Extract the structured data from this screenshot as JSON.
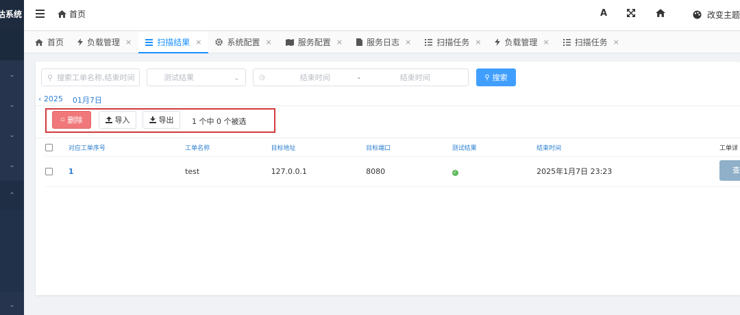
{
  "app": {
    "title_fragment": "估系统"
  },
  "header": {
    "breadcrumb": "首页",
    "tools": {
      "font_icon_label": "A",
      "theme_label": "改变主题"
    }
  },
  "tabs": [
    {
      "label": "首页",
      "icon": "home-icon",
      "closable": false,
      "active": false
    },
    {
      "label": "负载管理",
      "icon": "bolt-icon",
      "closable": true,
      "active": false
    },
    {
      "label": "扫描结果",
      "icon": "list-icon",
      "closable": true,
      "active": true
    },
    {
      "label": "系统配置",
      "icon": "gear-icon",
      "closable": true,
      "active": false
    },
    {
      "label": "服务配置",
      "icon": "map-icon",
      "closable": true,
      "active": false
    },
    {
      "label": "服务日志",
      "icon": "file-icon",
      "closable": true,
      "active": false
    },
    {
      "label": "扫描任务",
      "icon": "tasks-icon",
      "closable": true,
      "active": false
    },
    {
      "label": "负载管理",
      "icon": "bolt-icon",
      "closable": true,
      "active": false
    },
    {
      "label": "扫描任务",
      "icon": "tasks-icon",
      "closable": true,
      "active": false
    }
  ],
  "search": {
    "keyword_placeholder": "搜索工单名称,结束时间",
    "result_placeholder": "测试结果",
    "end_time_from_placeholder": "结束时间",
    "range_separator": "-",
    "end_time_to_placeholder": "结束时间",
    "search_button": "搜索"
  },
  "date_nav": {
    "year": "‹ 2025",
    "day": "01月7日"
  },
  "toolbar": {
    "delete_label": "删除",
    "import_label": "导入",
    "export_label": "导出",
    "selection_text": "1 个中 0 个被选"
  },
  "table": {
    "columns": [
      "对应工单序号",
      "工单名称",
      "目标地址",
      "目标端口",
      "测试结果",
      "结束时间",
      "工单详"
    ],
    "rows": [
      {
        "id": "1",
        "name": "test",
        "address": "127.0.0.1",
        "port": "8080",
        "result_icon": "check-circle-icon",
        "end_time": "2025年1月7日 23:23",
        "action": "查"
      }
    ]
  },
  "colors": {
    "accent": "#409eff",
    "danger": "#f0787a",
    "highlight_border": "#d0393a",
    "sidebar": "#26354d",
    "success": "#5cb85c"
  }
}
